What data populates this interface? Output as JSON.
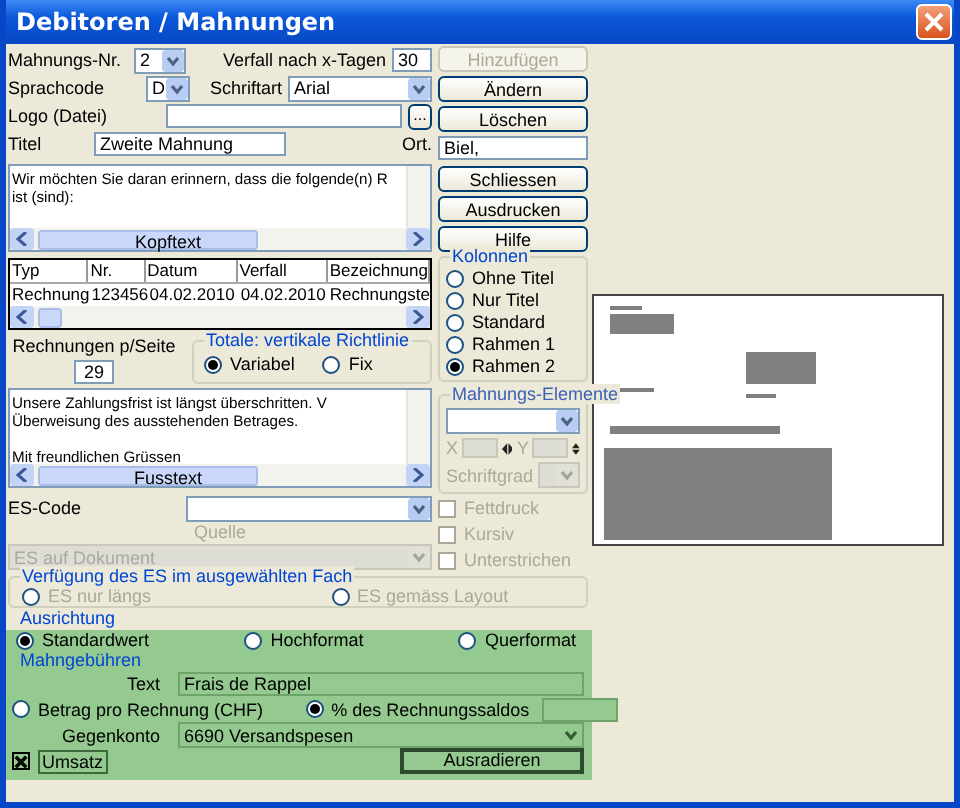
{
  "window": {
    "title": "Debitoren / Mahnungen"
  },
  "fields": {
    "mahnungs_nr": {
      "label": "Mahnungs-Nr.",
      "value": "2"
    },
    "verfall": {
      "label": "Verfall nach x-Tagen",
      "value": "30"
    },
    "sprachcode": {
      "label": "Sprachcode",
      "value": "D"
    },
    "schriftart": {
      "label": "Schriftart",
      "value": "Arial"
    },
    "logo": {
      "label": "Logo (Datei)",
      "browse": "..."
    },
    "titel": {
      "label": "Titel",
      "value": "Zweite Mahnung"
    },
    "ort": {
      "label": "Ort.",
      "value": "Biel,"
    }
  },
  "buttons_top": [
    {
      "label": "Hinzufügen",
      "disabled": true
    },
    {
      "label": "Ändern",
      "disabled": false
    },
    {
      "label": "Löschen",
      "disabled": false
    }
  ],
  "buttons_side": [
    {
      "label": "Schliessen",
      "disabled": false
    },
    {
      "label": "Ausdrucken",
      "disabled": false
    },
    {
      "label": "Hilfe",
      "disabled": false
    }
  ],
  "kopftext": {
    "lines": [
      "Wir möchten Sie daran erinnern, dass die folgende(n) R",
      "ist (sind):"
    ],
    "scroll_label": "Kopftext"
  },
  "table": {
    "columns": [
      "Typ",
      "Nr.",
      "Datum",
      "Verfall",
      "Bezeichnung"
    ],
    "rows": [
      [
        "Rechnung",
        "123456",
        "04.02.2010",
        "04.02.2010",
        "Rechnungste"
      ]
    ]
  },
  "kolonnen": {
    "title": "Kolonnen",
    "options": [
      {
        "label": "Ohne Titel",
        "selected": false
      },
      {
        "label": "Nur Titel",
        "selected": false
      },
      {
        "label": "Standard",
        "selected": false
      },
      {
        "label": "Rahmen 1",
        "selected": false
      },
      {
        "label": "Rahmen 2",
        "selected": true
      }
    ]
  },
  "rechnungen_pro_seite": {
    "label": "Rechnungen p/Seite",
    "value": "29"
  },
  "totale": {
    "title": "Totale: vertikale Richtlinie",
    "options": [
      {
        "label": "Variabel",
        "selected": true
      },
      {
        "label": "Fix",
        "selected": false
      }
    ]
  },
  "fusstext": {
    "paragraphs": [
      [
        "Unsere Zahlungsfrist ist längst überschritten. V",
        "Überweisung des ausstehenden Betrages."
      ],
      [
        "Mit freundlichen Grüssen"
      ]
    ],
    "scroll_label": "Fusstext"
  },
  "mahnungs_elemente": {
    "title": "Mahnungs-Elemente",
    "x_label": "X",
    "y_label": "Y",
    "schriftgrad_label": "Schriftgrad",
    "disabled": true
  },
  "es_code": {
    "label": "ES-Code"
  },
  "styles": [
    {
      "label": "Fettdruck",
      "checked": false,
      "disabled": true
    },
    {
      "label": "Kursiv",
      "checked": false,
      "disabled": true
    },
    {
      "label": "Unterstrichen",
      "checked": false,
      "disabled": true
    }
  ],
  "quelle": {
    "label": "Quelle",
    "value": "ES auf Dokument",
    "disabled": true
  },
  "verfuegung": {
    "title": "Verfügung des ES im ausgewählten Fach",
    "options": [
      {
        "label": "ES nur längs",
        "selected": false,
        "disabled": true
      },
      {
        "label": "ES gemäss Layout",
        "selected": false,
        "disabled": true
      }
    ]
  },
  "ausrichtung": {
    "title": "Ausrichtung",
    "options": [
      {
        "label": "Standardwert",
        "selected": true
      },
      {
        "label": "Hochformat",
        "selected": false
      },
      {
        "label": "Querformat",
        "selected": false
      }
    ]
  },
  "mahngebuehren": {
    "title": "Mahngebühren",
    "text_label": "Text",
    "text_value": "Frais de Rappel",
    "options": [
      {
        "label": "Betrag pro Rechnung (CHF)",
        "selected": false
      },
      {
        "label": "% des Rechnungssaldos",
        "selected": true
      }
    ],
    "gegenkonto_label": "Gegenkonto",
    "gegenkonto": "6690 Versandspesen"
  },
  "umsatz": {
    "label": "Umsatz",
    "checked": true
  },
  "ausradieren": {
    "label": "Ausradieren"
  }
}
